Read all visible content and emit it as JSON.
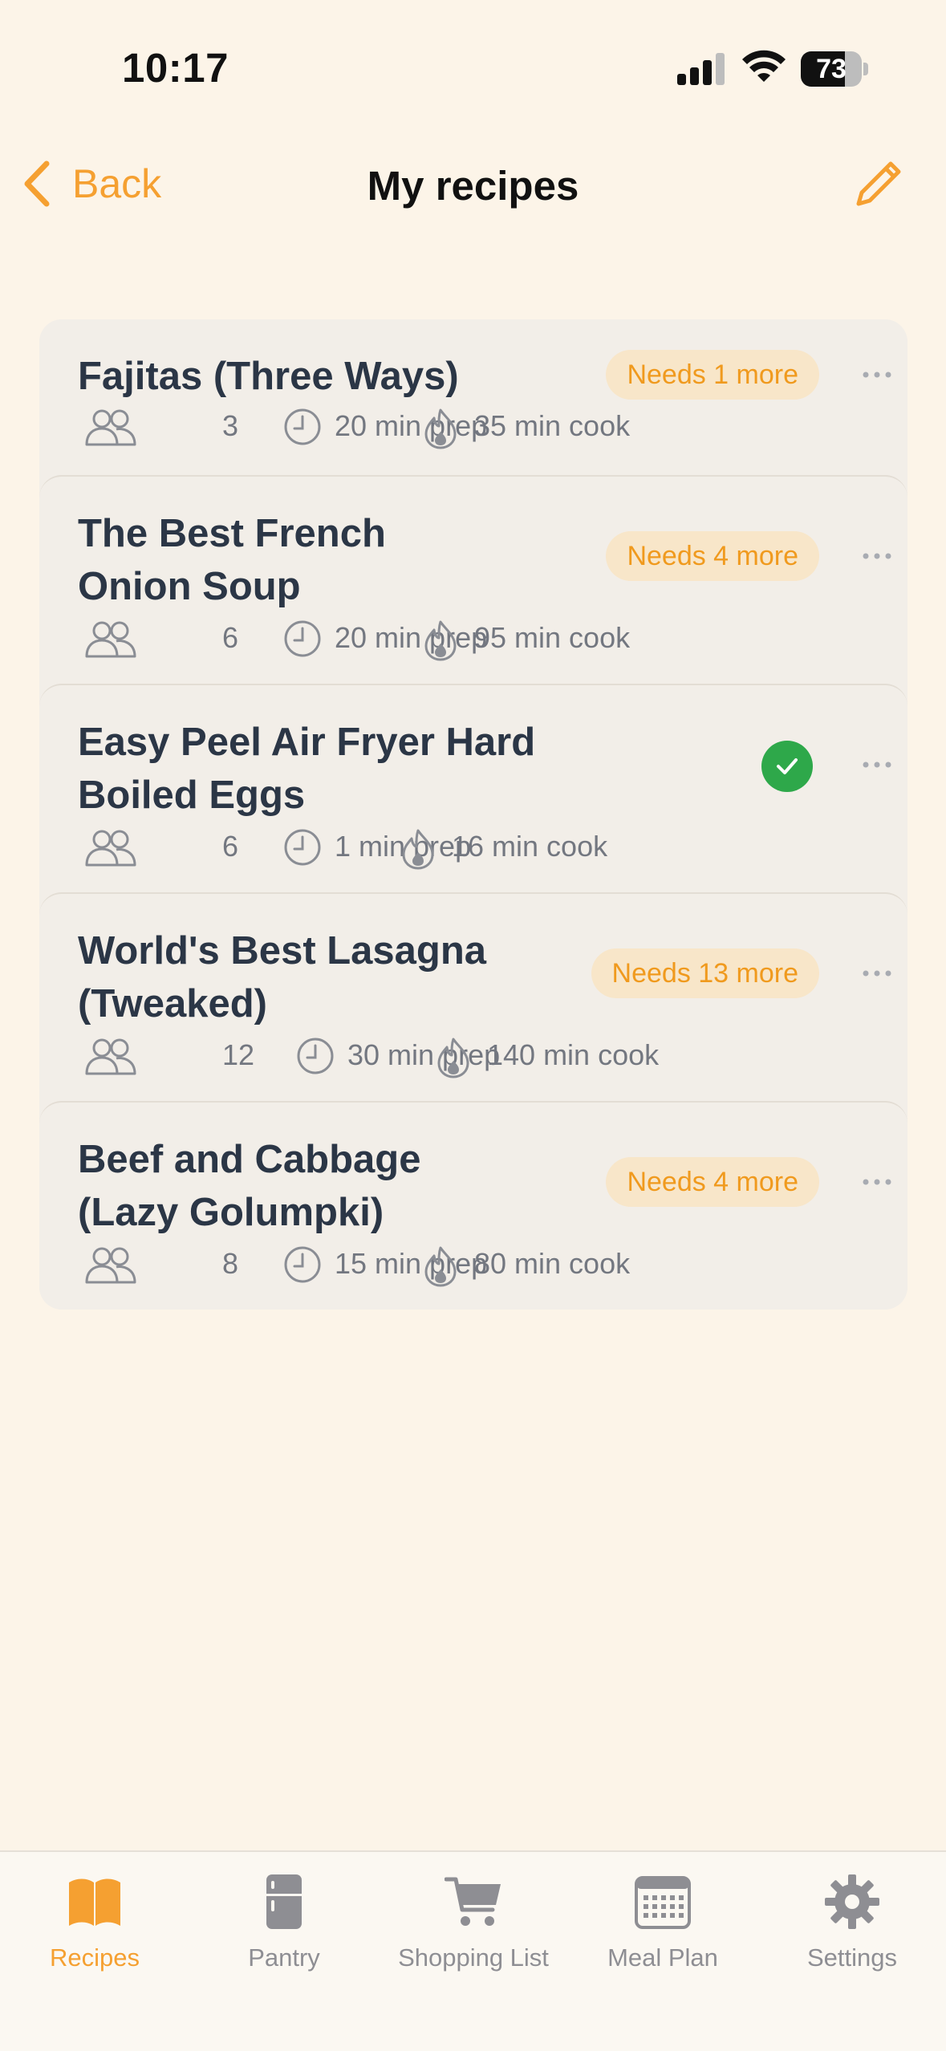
{
  "status_bar": {
    "time": "10:17",
    "battery_level": "73",
    "battery_fraction": 0.73
  },
  "nav": {
    "back_label": "Back",
    "title": "My recipes",
    "edit_icon": "pencil-icon"
  },
  "recipes": [
    {
      "title_lines": [
        "Fajitas (Three Ways)"
      ],
      "badge": "Needs 1 more",
      "complete": false,
      "servings": "3",
      "prep": "20 min prep",
      "cook": "35 min cook"
    },
    {
      "title_lines": [
        "The Best French",
        "Onion Soup"
      ],
      "badge": "Needs 4 more",
      "complete": false,
      "servings": "6",
      "prep": "20 min prep",
      "cook": "95 min cook"
    },
    {
      "title_lines": [
        "Easy Peel Air Fryer Hard",
        "Boiled Eggs"
      ],
      "badge": "",
      "complete": true,
      "servings": "6",
      "prep": "1 min prep",
      "cook": "16 min cook"
    },
    {
      "title_lines": [
        "World's Best Lasagna",
        "(Tweaked)"
      ],
      "badge": "Needs 13 more",
      "complete": false,
      "servings": "12",
      "prep": "30 min prep",
      "cook": "140 min cook"
    },
    {
      "title_lines": [
        "Beef and Cabbage",
        "(Lazy Golumpki)"
      ],
      "badge": "Needs 4 more",
      "complete": false,
      "servings": "8",
      "prep": "15 min prep",
      "cook": "80 min cook"
    }
  ],
  "tabs": [
    {
      "label": "Recipes",
      "icon": "book-icon",
      "active": true
    },
    {
      "label": "Pantry",
      "icon": "fridge-icon",
      "active": false
    },
    {
      "label": "Shopping List",
      "icon": "cart-icon",
      "active": false
    },
    {
      "label": "Meal Plan",
      "icon": "calendar-icon",
      "active": false
    },
    {
      "label": "Settings",
      "icon": "gear-icon",
      "active": false
    }
  ],
  "colors": {
    "accent": "#f5a031",
    "background": "#fcf4e8",
    "card": "#f2eee8",
    "badge_bg": "#f8e6c9",
    "badge_text": "#f09a1e",
    "success": "#2ea84a",
    "muted": "#737780"
  }
}
